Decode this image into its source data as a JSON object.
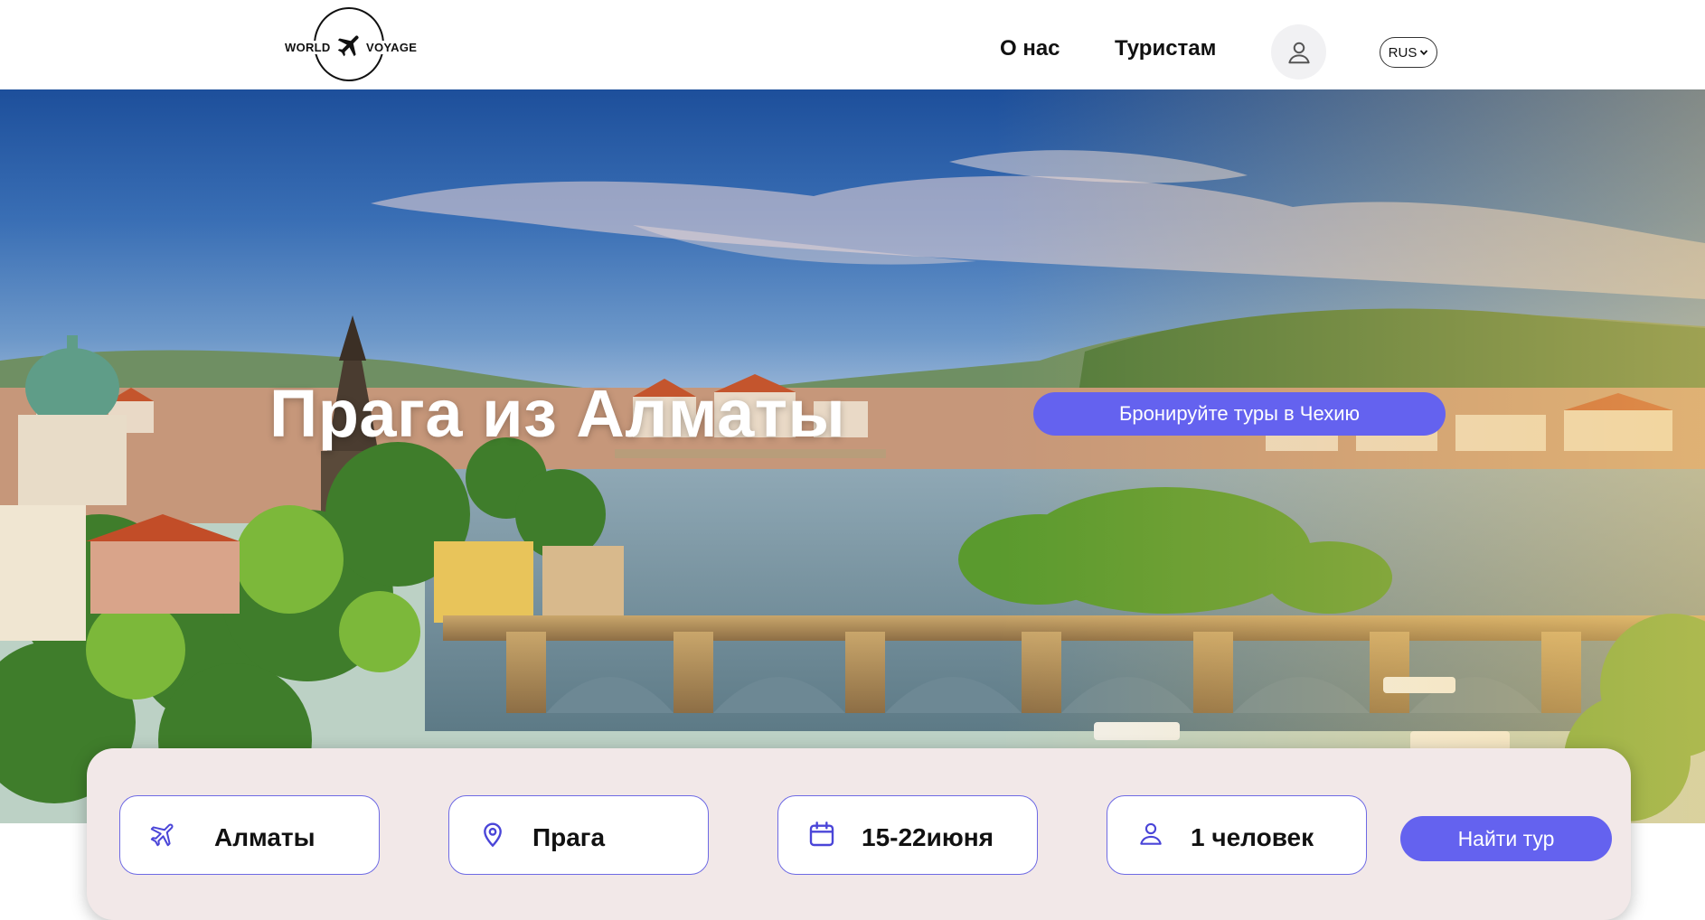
{
  "header": {
    "logo": {
      "word_left": "WORLD",
      "word_right": "VOYAGE",
      "icon": "airplane-icon"
    },
    "nav": [
      {
        "label": "О нас"
      },
      {
        "label": "Туристам"
      }
    ],
    "profile_icon": "user-icon",
    "language": {
      "selected": "RUS",
      "icon": "chevron-down-icon"
    }
  },
  "hero": {
    "title": "Прага из Алматы",
    "cta_label": "Бронируйте туры в Чехию"
  },
  "search": {
    "from": {
      "value": "Алматы",
      "icon": "airplane-icon"
    },
    "to": {
      "value": "Прага",
      "icon": "location-pin-icon"
    },
    "dates": {
      "value": "15-22июня",
      "icon": "calendar-icon"
    },
    "travelers": {
      "value": "1 человек",
      "icon": "user-icon"
    },
    "submit_label": "Найти тур"
  },
  "colors": {
    "accent": "#6462ef",
    "field_border": "#6e6ae4",
    "panel_background": "#f2e8e8"
  }
}
